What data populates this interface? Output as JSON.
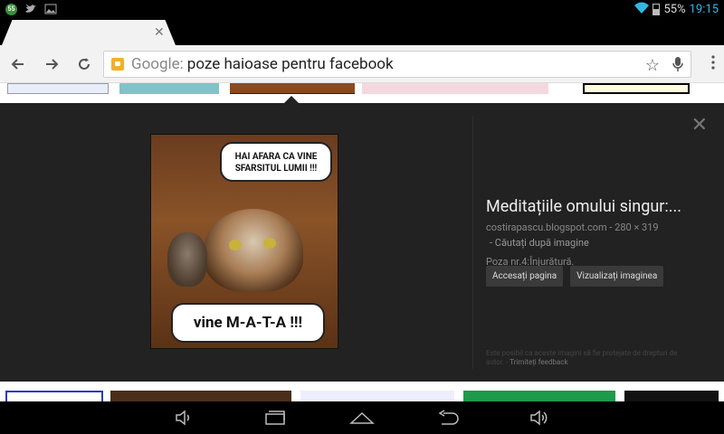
{
  "status": {
    "notif_badge": "55",
    "battery_pct": "55%",
    "time": "19:15"
  },
  "omnibox": {
    "prefix": "Google:",
    "query": "poze haioase pentru facebook"
  },
  "preview": {
    "title": "Meditațiile omului singur:...",
    "source": "costirapascu.blogspot.com",
    "size": "280 × 319",
    "search_by_image": "Căutați după imagine",
    "description": "Poza nr.4:Înjurătură.",
    "visit_label": "Accesați pagina",
    "view_label": "Vizualizați imaginea",
    "notice": "Este posibil ca aceste imagini să fie protejate de drepturi de autor.",
    "feedback_label": "Trimiteți feedback",
    "bubble_top": "HAI AFARA CA VINE SFARSITUL LUMII !!!",
    "bubble_bottom": "vine M-A-T-A  !!!"
  }
}
